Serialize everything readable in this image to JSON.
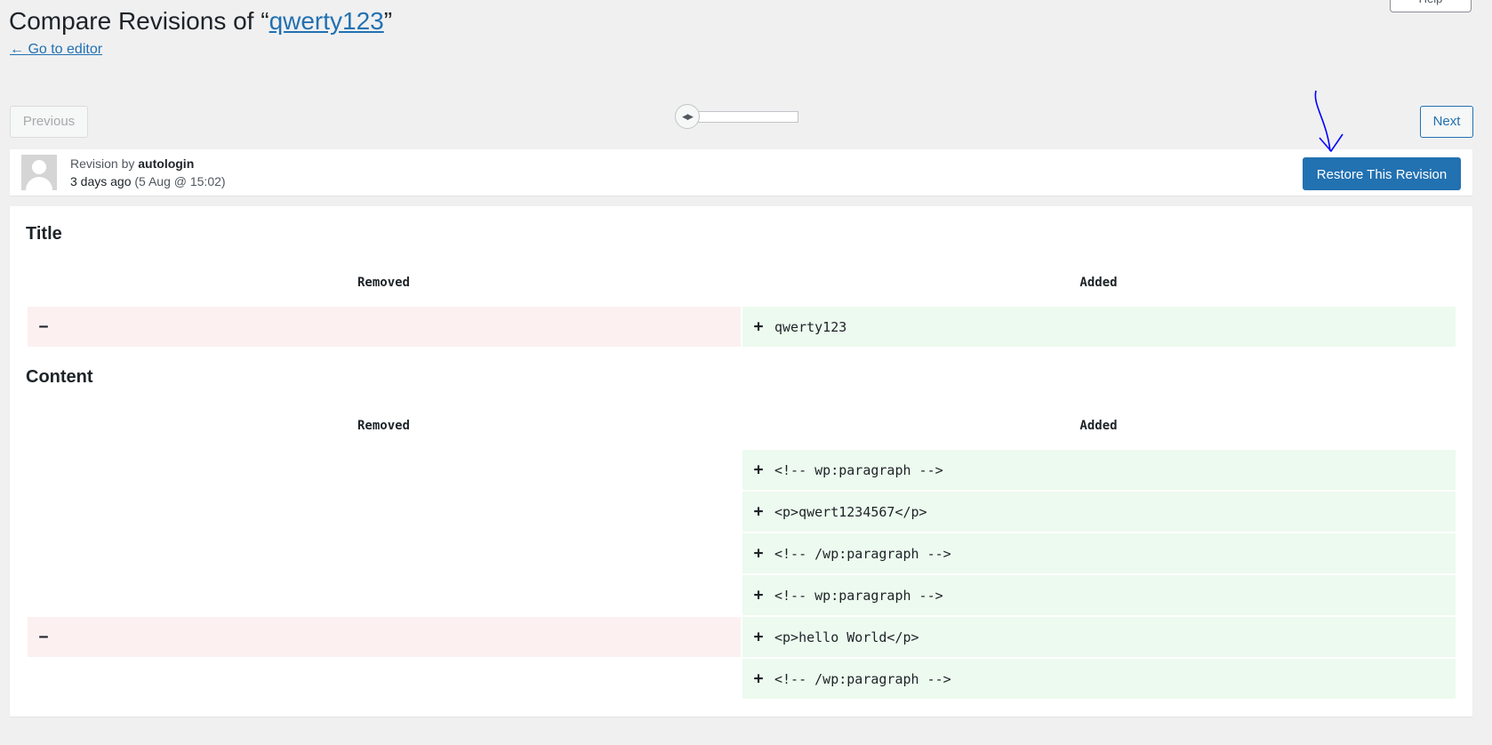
{
  "header": {
    "title_prefix": "Compare Revisions of “",
    "title_link": "qwerty123",
    "title_suffix": "”",
    "back_link": "← Go to editor",
    "help_label": "Help"
  },
  "nav": {
    "previous_label": "Previous",
    "next_label": "Next",
    "slider_handle_glyph": "◀▶"
  },
  "revision": {
    "by_label": "Revision by ",
    "author": "autologin",
    "time_ago": "3 days ago",
    "date": " (5 Aug @ 15:02)",
    "restore_label": "Restore This Revision"
  },
  "diff": {
    "title_section": {
      "heading": "Title",
      "removed_header": "Removed",
      "added_header": "Added",
      "rows": [
        {
          "removed": "",
          "removed_sign": "−",
          "added": "qwerty123",
          "added_sign": "+"
        }
      ]
    },
    "content_section": {
      "heading": "Content",
      "removed_header": "Removed",
      "added_header": "Added",
      "rows": [
        {
          "removed_sign": "",
          "removed": "",
          "added_sign": "+",
          "added": "<!-- wp:paragraph -->"
        },
        {
          "removed_sign": "",
          "removed": "",
          "added_sign": "+",
          "added": "<p>qwert1234567</p>"
        },
        {
          "removed_sign": "",
          "removed": "",
          "added_sign": "+",
          "added": "<!-- /wp:paragraph -->"
        },
        {
          "removed_sign": "",
          "removed": "",
          "added_sign": "+",
          "added": "<!-- wp:paragraph -->"
        },
        {
          "removed_sign": "−",
          "removed": "",
          "added_sign": "+",
          "added": "<p>hello World</p>"
        },
        {
          "removed_sign": "",
          "removed": "",
          "added_sign": "+",
          "added": "<!-- /wp:paragraph -->"
        }
      ]
    }
  },
  "colors": {
    "accent": "#2271b1",
    "removed_bg": "#fcf0f1",
    "added_bg": "#edfaef",
    "annotation": "#0000ff"
  }
}
